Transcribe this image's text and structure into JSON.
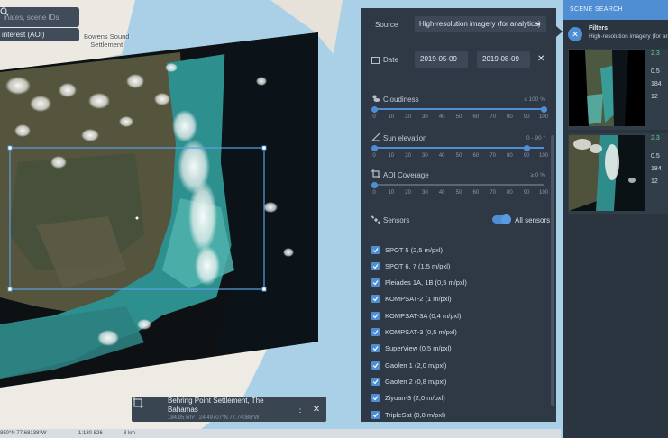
{
  "map": {
    "search_placeholder": "inates, scene IDs",
    "aoi_label": "interest (AOI)",
    "place_label_line1": "Bowens Sound",
    "place_label_line2": "Settlement",
    "location": {
      "title": "Behring Point Settlement, The Bahamas",
      "subtitle": "184.95 km² | 24.49707°N 77.74088°W"
    },
    "status": {
      "coords": "850°N 77.68138°W",
      "scale": "1:130 826",
      "distance": "3 km"
    }
  },
  "filters": {
    "source_label": "Source",
    "source_value": "High-resolution imagery (for analytics)",
    "date_label": "Date",
    "date_from": "2019-05-09",
    "date_to": "2019-08-09",
    "sliders": [
      {
        "title": "Cloudiness",
        "range": "≤ 100 %",
        "value_min": 0,
        "value_max": 100,
        "icon": "cloud-sun-icon"
      },
      {
        "title": "Sun elevation",
        "range": "0 - 90 °",
        "value_min": 0,
        "value_max": 90,
        "icon": "sun-angle-icon"
      },
      {
        "title": "AOI Coverage",
        "range": "≥ 0 %",
        "value_min": 0,
        "value_max": 0,
        "icon": "crop-icon"
      }
    ],
    "tick_labels": [
      "0",
      "10",
      "20",
      "30",
      "40",
      "50",
      "60",
      "70",
      "80",
      "90",
      "100"
    ],
    "sensors_label": "Sensors",
    "all_sensors_label": "All sensors",
    "all_sensors_on": true,
    "sensors": [
      "SPOT 5 (2,5 m/pxl)",
      "SPOT 6, 7 (1,5 m/pxl)",
      "Pleiades 1A, 1B (0,5 m/pxl)",
      "KOMPSAT-2 (1 m/pxl)",
      "KOMPSAT-3A (0,4 m/pxl)",
      "KOMPSAT-3 (0,5 m/pxl)",
      "SuperView (0,5 m/pxl)",
      "Gaofen 1 (2,0 m/pxl)",
      "Gaofen 2 (0,8 m/pxl)",
      "Ziyuan-3 (2,0 m/pxl)",
      "TripleSat (0,8 m/pxl)"
    ],
    "accent_color": "#4f8ed3"
  },
  "scene_search": {
    "header": "SCENE SEARCH",
    "filters_title": "Filters",
    "filters_subtitle": "High-resolution imagery (for ar",
    "cards": [
      {
        "line1": "2.3",
        "line2": "0.5",
        "line3": "184",
        "line4": "12"
      },
      {
        "line1": "2.3",
        "line2": "0.5",
        "line3": "184",
        "line4": "12"
      }
    ]
  }
}
